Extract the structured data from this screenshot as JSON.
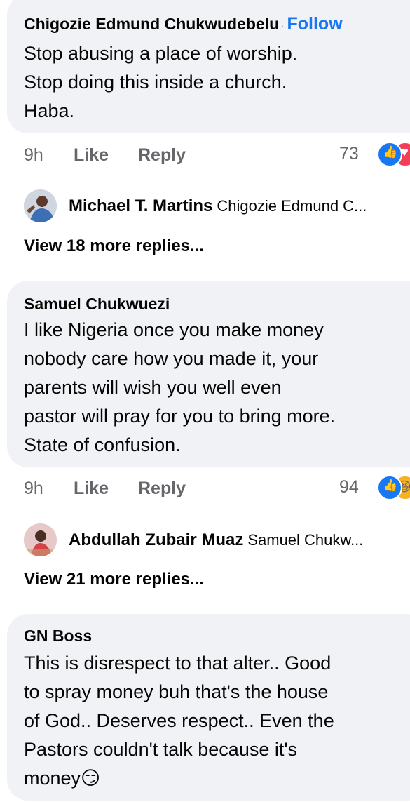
{
  "comments": [
    {
      "author": "Chigozie Edmund Chukwudebelu",
      "follow": "Follow",
      "separator": "·",
      "lines": [
        "Stop abusing a place of worship.",
        "Stop doing this inside a church.",
        "Haba."
      ],
      "time": "9h",
      "like": "Like",
      "reply": "Reply",
      "reaction_count": "73",
      "reactions": [
        "like-icon",
        "love-icon"
      ],
      "latest_reply": {
        "author": "Michael T. Martins",
        "preview": "Chigozie Edmund C..."
      },
      "view_more": "View 18 more replies..."
    },
    {
      "author": "Samuel Chukwuezi",
      "lines": [
        "I like Nigeria once you make money",
        "nobody care how you made it, your",
        "parents will wish you well even",
        "pastor will pray for you to bring more.",
        "State of confusion."
      ],
      "time": "9h",
      "like": "Like",
      "reply": "Reply",
      "reaction_count": "94",
      "reactions": [
        "like-icon",
        "haha-icon"
      ],
      "latest_reply": {
        "author": "Abdullah Zubair Muaz",
        "preview": "Samuel Chukw..."
      },
      "view_more": "View 21 more replies..."
    },
    {
      "author": "GN Boss",
      "lines": [
        "This is disrespect to that alter.. Good",
        "to spray money buh that's the house",
        "of God.. Deserves respect.. Even the",
        "Pastors couldn't talk because it's",
        "money😏"
      ]
    }
  ],
  "colors": {
    "bubble": "#f0f2f5",
    "link": "#1877f2",
    "meta": "#65676b",
    "text": "#050505"
  }
}
